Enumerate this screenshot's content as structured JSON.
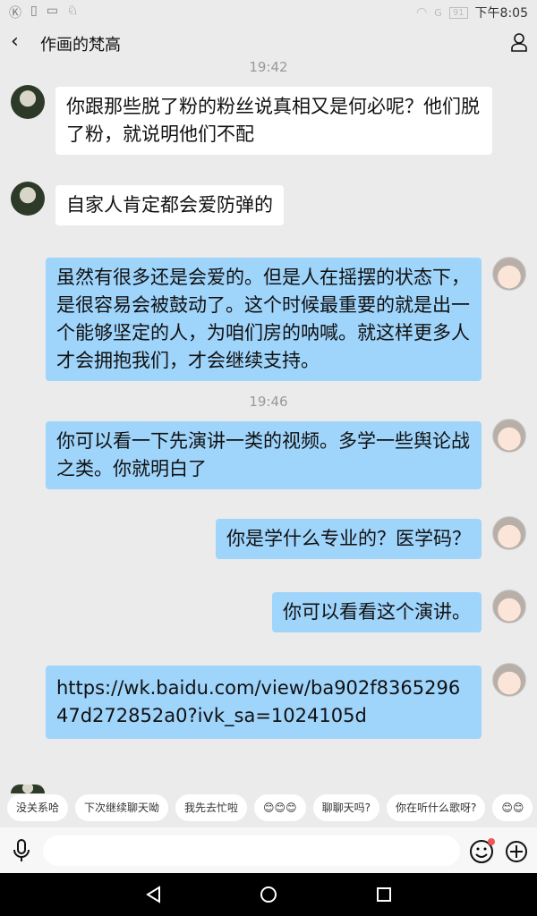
{
  "status": {
    "battery": "91",
    "time": "下午8:05",
    "network": "G"
  },
  "header": {
    "title": "作画的梵高"
  },
  "messages": [
    {
      "type": "time",
      "text": "19:42"
    },
    {
      "from": "other",
      "text": "你跟那些脱了粉的粉丝说真相又是何必呢？他们脱了粉，就说明他们不配"
    },
    {
      "from": "other",
      "text": "自家人肯定都会爱防弹的"
    },
    {
      "from": "me",
      "text": "虽然有很多还是会爱的。但是人在摇摆的状态下，是很容易会被鼓动了。这个时候最重要的就是出一个能够坚定的人，为咱们房的呐喊。就这样更多人才会拥抱我们，才会继续支持。"
    },
    {
      "type": "time",
      "text": "19:46"
    },
    {
      "from": "me",
      "text": "你可以看一下先演讲一类的视频。多学一些舆论战之类。你就明白了"
    },
    {
      "from": "me",
      "text": "你是学什么专业的？医学码？"
    },
    {
      "from": "me",
      "text": "你可以看看这个演讲。"
    },
    {
      "from": "me",
      "text": "https://wk.baidu.com/view/ba902f836529647d272852a0?ivk_sa=1024105d"
    }
  ],
  "quick_replies": [
    "没关系哈",
    "下次继续聊天呦",
    "我先去忙啦",
    "😊😊😊",
    "聊聊天吗?",
    "你在听什么歌呀?",
    "😊😊"
  ]
}
